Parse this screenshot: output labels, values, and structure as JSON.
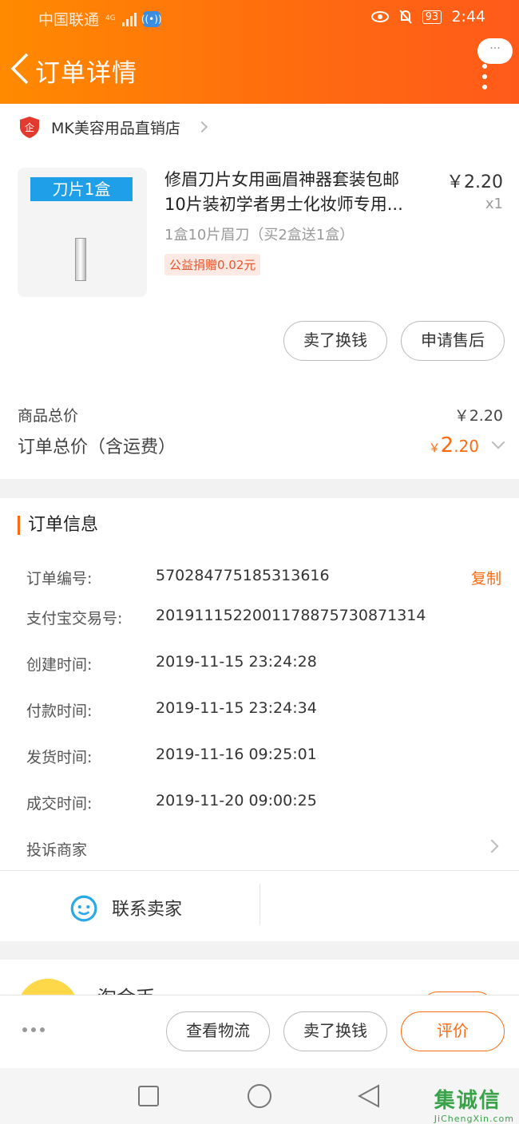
{
  "status_bar": {
    "carrier": "中国联通",
    "network": "4G",
    "battery": "93",
    "time": "2:44"
  },
  "nav": {
    "title": "订单详情",
    "more_bubble": "···"
  },
  "shop": {
    "name": "MK美容用品直销店"
  },
  "product": {
    "thumb_label": "刀片1盒",
    "title_line1": "修眉刀片女用画眉神器套装包邮",
    "title_line2": "10片装初学者男士化妆师专用...",
    "price": "￥2.20",
    "qty": "x1",
    "sku": "1盒10片眉刀（买2盒送1盒）",
    "tag": "公益捐赠0.02元",
    "buttons": [
      "卖了换钱",
      "申请售后"
    ]
  },
  "summary": {
    "goods_label": "商品总价",
    "goods_value": "￥2.20",
    "order_label": "订单总价（含运费）",
    "order_currency": "￥",
    "order_int": "2",
    "order_dec": ".20"
  },
  "order_info": {
    "title": "订单信息",
    "copy_label": "复制",
    "rows": [
      {
        "k": "订单编号:",
        "v": "570284775185313616"
      },
      {
        "k": "支付宝交易号:",
        "v": "2019111522001178875730871314"
      },
      {
        "k": "创建时间:",
        "v": "2019-11-15 23:24:28"
      },
      {
        "k": "付款时间:",
        "v": "2019-11-15 23:24:34"
      },
      {
        "k": "发货时间:",
        "v": "2019-11-16 09:25:01"
      },
      {
        "k": "成交时间:",
        "v": "2019-11-20 09:00:25"
      }
    ],
    "complain": "投诉商家"
  },
  "contact": {
    "label": "联系卖家"
  },
  "partial": {
    "text": "淘金币"
  },
  "bottom_bar": {
    "buttons": [
      "查看物流",
      "卖了换钱",
      "评价"
    ]
  },
  "watermark": {
    "title": "集诚信",
    "url": "JiChengXin.com"
  },
  "colors": {
    "accent": "#ff6a10",
    "header_start": "#ff8a00",
    "link_blue": "#2aa8e8"
  }
}
